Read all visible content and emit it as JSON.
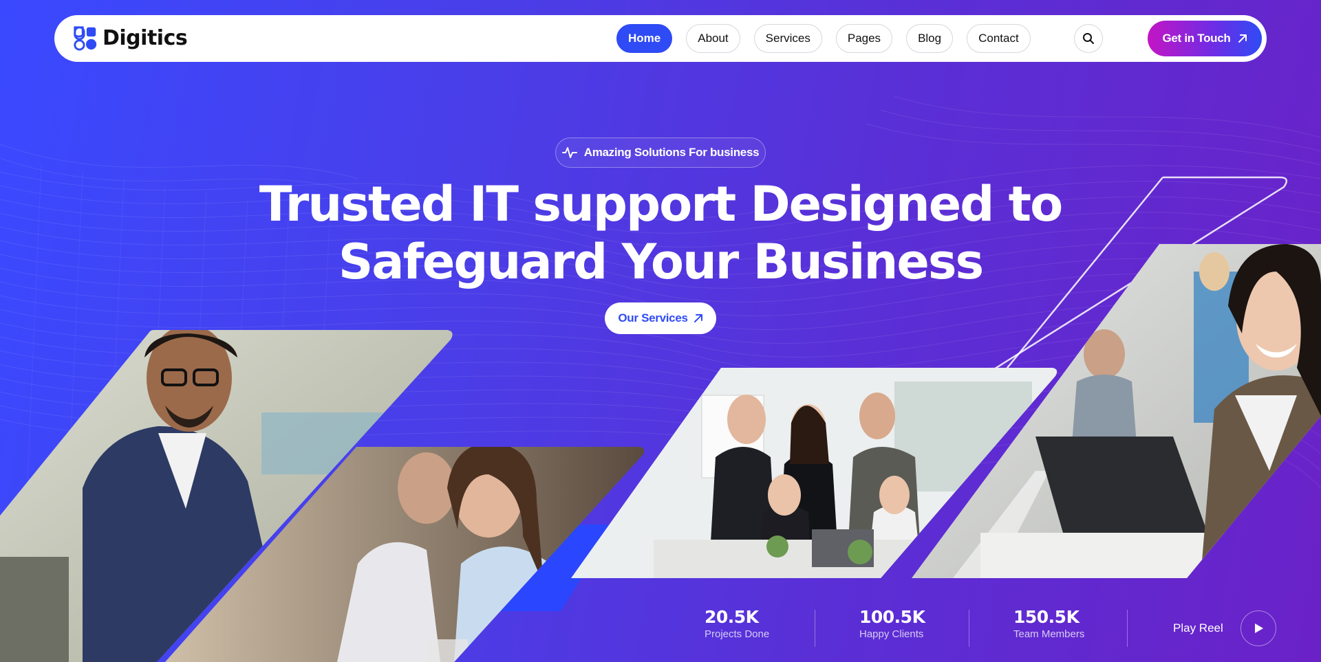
{
  "brand": {
    "name": "Digitics",
    "logo_icon": "digitics-logo-icon"
  },
  "nav": {
    "items": [
      {
        "label": "Home",
        "active": true
      },
      {
        "label": "About",
        "active": false
      },
      {
        "label": "Services",
        "active": false
      },
      {
        "label": "Pages",
        "active": false
      },
      {
        "label": "Blog",
        "active": false
      },
      {
        "label": "Contact",
        "active": false
      }
    ],
    "search_icon": "search-icon",
    "cta_label": "Get in Touch",
    "cta_icon": "arrow-up-right-icon"
  },
  "hero": {
    "badge": "Amazing Solutions For business",
    "badge_icon": "pulse-icon",
    "title_line1": "Trusted IT support Designed to",
    "title_line2": "Safeguard Your Business",
    "button_label": "Our Services",
    "button_icon": "arrow-up-right-icon"
  },
  "stats": [
    {
      "value": "20.5K",
      "label": "Projects Done"
    },
    {
      "value": "100.5K",
      "label": "Happy Clients"
    },
    {
      "value": "150.5K",
      "label": "Team Members"
    }
  ],
  "play": {
    "label": "Play Reel",
    "icon": "play-icon"
  },
  "colors": {
    "accent": "#2f4bf5",
    "cta_gradient_start": "#c315c4",
    "background_start": "#3a49ff",
    "background_end": "#6a22c8"
  }
}
